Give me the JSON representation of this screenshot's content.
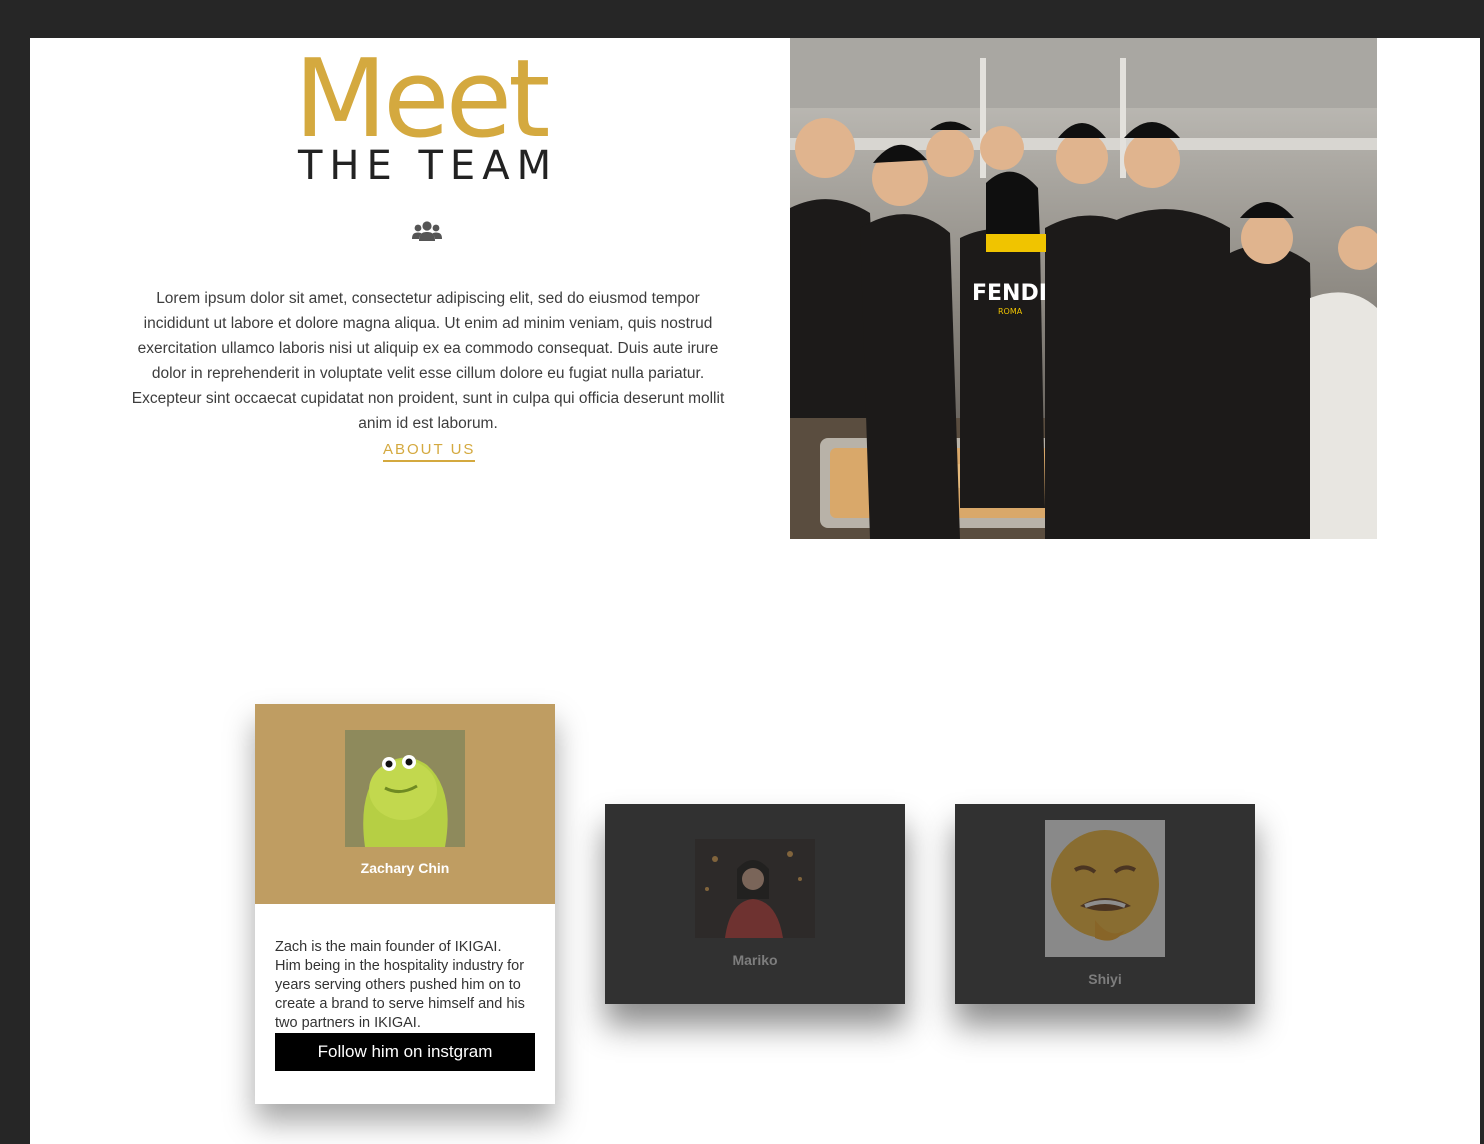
{
  "intro": {
    "title_meet": "Meet",
    "title_team": "THE TEAM",
    "icon": "users-icon",
    "body": "Lorem ipsum dolor sit amet, consectetur adipiscing elit, sed do eiusmod tempor incididunt ut labore et dolore magna aliqua. Ut enim ad minim veniam, quis nostrud exercitation ullamco laboris nisi ut aliquip ex ea commodo consequat. Duis aute irure dolor in reprehenderit in voluptate velit esse cillum dolore eu fugiat nulla pariatur. Excepteur sint occaecat cupidatat non proident, sunt in culpa qui officia deserunt mollit anim id est laborum.",
    "about_link": "ABOUT US"
  },
  "team_photo": {
    "shirt_text": "FENDI",
    "shirt_sub": "ROMA"
  },
  "members": {
    "zach": {
      "name": "Zachary Chin",
      "bio": "Zach is the main founder of IKIGAI. Him being in the hospitality industry for years serving others pushed him on to create a brand to serve himself and his two partners in IKIGAI.",
      "button": "Follow him on instgram"
    },
    "mariko": {
      "name": "Mariko"
    },
    "shiyi": {
      "name": "Shiyi"
    }
  },
  "colors": {
    "accent": "#d4a93f",
    "card_featured": "#bf9d62",
    "card_dark": "#313131",
    "frame": "#262626"
  }
}
